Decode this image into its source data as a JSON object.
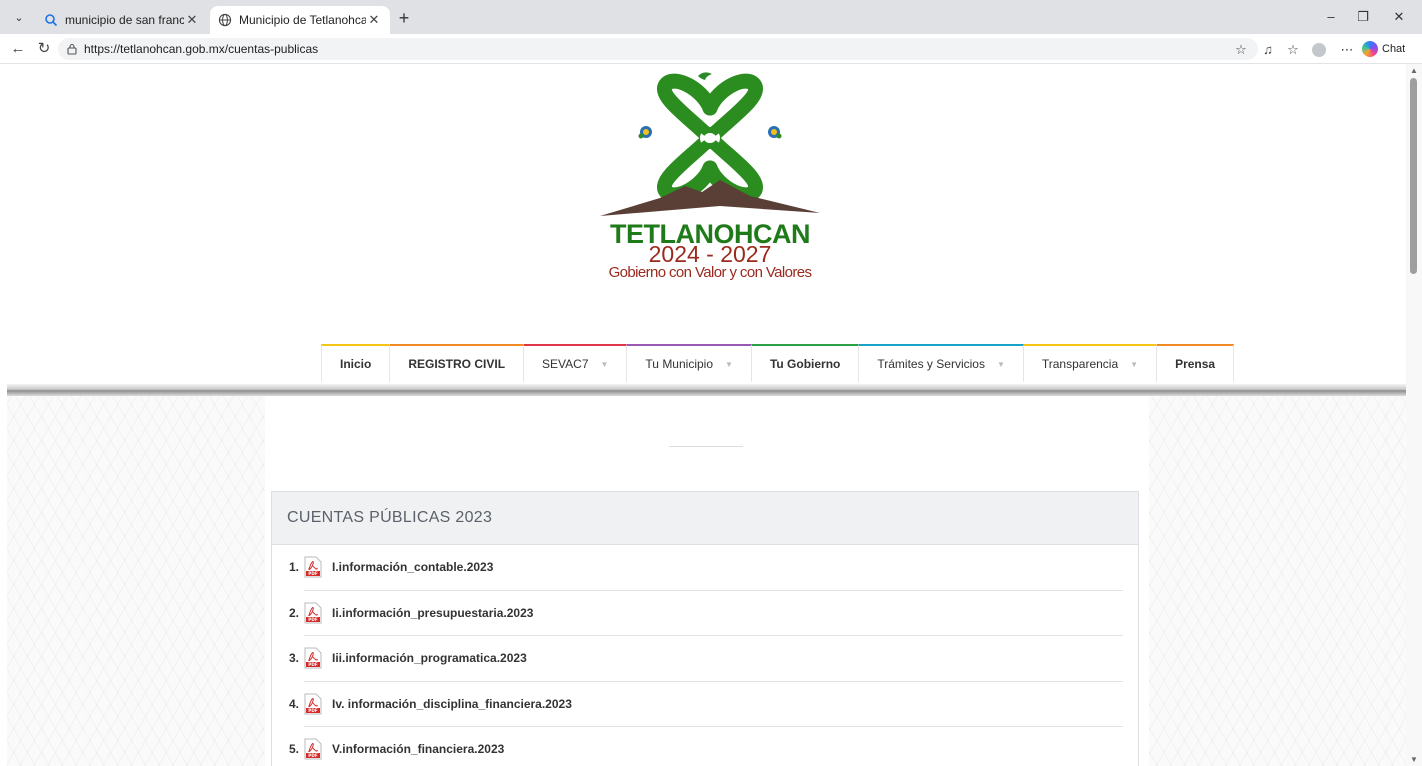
{
  "browser": {
    "tabs": [
      {
        "title": "municipio de san francisco tetlanc",
        "active": false
      },
      {
        "title": "Municipio de Tetlanohcan",
        "active": true
      }
    ],
    "url": "https://tetlanohcan.gob.mx/cuentas-publicas",
    "chat_label": "Chat"
  },
  "header": {
    "logo_title": "TETLANOHCAN",
    "logo_years": "2024 - 2027",
    "logo_slogan": "Gobierno con Valor y con Valores"
  },
  "nav": [
    {
      "label": "Inicio",
      "bold": true,
      "caret": false,
      "color": "#f5c518"
    },
    {
      "label": "REGISTRO CIVIL",
      "bold": true,
      "caret": false,
      "color": "#f08a24"
    },
    {
      "label": "SEVAC7",
      "bold": false,
      "caret": true,
      "color": "#e0354b"
    },
    {
      "label": "Tu Municipio",
      "bold": false,
      "caret": true,
      "color": "#9b59b6"
    },
    {
      "label": "Tu Gobierno",
      "bold": true,
      "caret": false,
      "color": "#2e9e45"
    },
    {
      "label": "Trámites y Servicios",
      "bold": false,
      "caret": true,
      "color": "#1aa3c9"
    },
    {
      "label": "Transparencia",
      "bold": false,
      "caret": true,
      "color": "#f5c518"
    },
    {
      "label": "Prensa",
      "bold": true,
      "caret": false,
      "color": "#f08a24"
    }
  ],
  "panel": {
    "title": "CUENTAS PÚBLICAS 2023",
    "items": [
      {
        "num": "1.",
        "label": "I.información_contable.2023"
      },
      {
        "num": "2.",
        "label": "Ii.información_presupuestaria.2023"
      },
      {
        "num": "3.",
        "label": "Iii.información_programatica.2023"
      },
      {
        "num": "4.",
        "label": "Iv. información_disciplina_financiera.2023"
      },
      {
        "num": "5.",
        "label": "V.información_financiera.2023"
      }
    ]
  }
}
